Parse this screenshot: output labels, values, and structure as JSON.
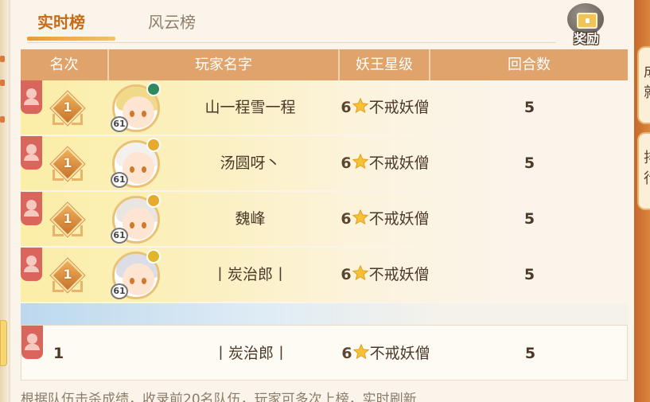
{
  "tabs": [
    {
      "label": "实时榜",
      "active": true
    },
    {
      "label": "风云榜",
      "active": false
    }
  ],
  "reward_button": {
    "label": "奖励",
    "icon": "chest-icon"
  },
  "table": {
    "headers": [
      "名次",
      "玩家名字",
      "妖王星级",
      "回合数"
    ],
    "rows": [
      {
        "rank": "1",
        "level": "61",
        "name": "山一程雪一程",
        "star_num": "6",
        "star_title": "不戒妖僧",
        "rounds": "5",
        "element_color": "#2e8a5c",
        "hair_color": "#f1d98a"
      },
      {
        "rank": "1",
        "level": "61",
        "name": "汤圆呀丶",
        "star_num": "6",
        "star_title": "不戒妖僧",
        "rounds": "5",
        "element_color": "#e7a92e",
        "hair_color": "#f4f0ee"
      },
      {
        "rank": "1",
        "level": "61",
        "name": "魏峰",
        "star_num": "6",
        "star_title": "不戒妖僧",
        "rounds": "5",
        "element_color": "#e7a92e",
        "hair_color": "#e9e6e2"
      },
      {
        "rank": "1",
        "level": "61",
        "name": "丨炭治郎丨",
        "star_num": "6",
        "star_title": "不戒妖僧",
        "rounds": "5",
        "element_color": "#e0b62a",
        "hair_color": "#dcdde6"
      }
    ]
  },
  "my_row": {
    "rank": "1",
    "name": "丨炭治郎丨",
    "star_num": "6",
    "star_title": "不戒妖僧",
    "rounds": "5"
  },
  "footnote": "根据队伍击杀成绩，收录前20名队伍，玩家可多次上榜，实时刷新",
  "colors": {
    "accent": "#c76a17",
    "header_bg": "#e0a36b",
    "row_gold": "#fbeea7",
    "badge_red": "#d8665d"
  }
}
